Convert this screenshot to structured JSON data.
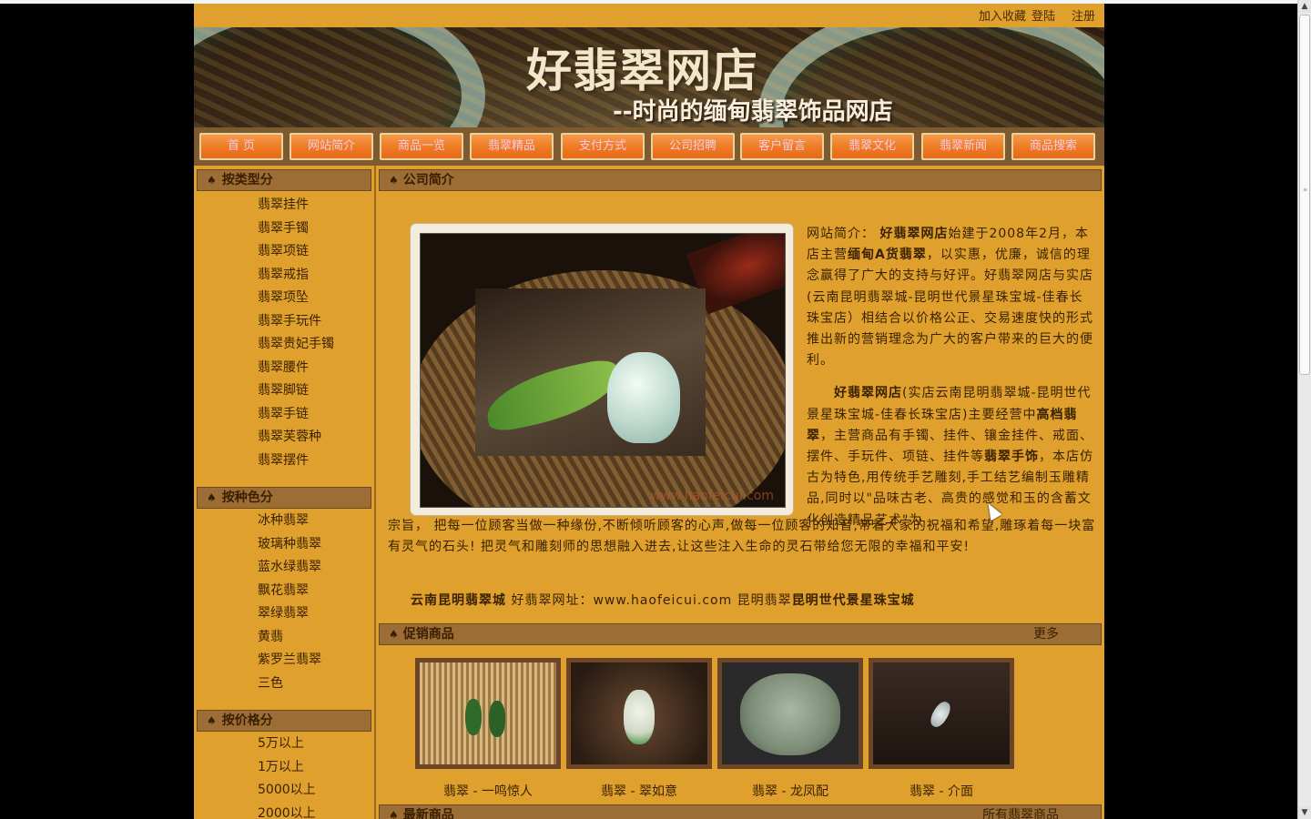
{
  "header": {
    "links": [
      "加入收藏",
      "登陆",
      "注册"
    ],
    "title": "好翡翠网店",
    "subtitle": "--时尚的缅甸翡翠饰品网店"
  },
  "nav": [
    "首 页",
    "网站简介",
    "商品一览",
    "翡翠精品",
    "支付方式",
    "公司招聘",
    "客户留言",
    "翡翠文化",
    "翡翠新闻",
    "商品搜索"
  ],
  "sidebar": {
    "type": {
      "title": "按类型分",
      "items": [
        "翡翠挂件",
        "翡翠手镯",
        "翡翠项链",
        "翡翠戒指",
        "翡翠项坠",
        "翡翠手玩件",
        "翡翠贵妃手镯",
        "翡翠腰件",
        "翡翠脚链",
        "翡翠手链",
        "翡翠芙蓉种",
        "翡翠摆件"
      ]
    },
    "color": {
      "title": "按种色分",
      "items": [
        "冰种翡翠",
        "玻璃种翡翠",
        "蓝水绿翡翠",
        "飘花翡翠",
        "翠绿翡翠",
        "黄翡",
        "紫罗兰翡翠",
        "三色"
      ]
    },
    "price": {
      "title": "按价格分",
      "items": [
        "5万以上",
        "1万以上",
        "5000以上",
        "2000以上"
      ]
    }
  },
  "about": {
    "title": "公司简介",
    "watermark": "www.haofeicui.com",
    "p1_label": "网站简介：",
    "p1_brand": "好翡翠网店",
    "p1_a": "始建于2008年2月，本店主营",
    "p1_b": "缅甸A货翡翠",
    "p1_c": "，以实惠，优廉，诚信的理念赢得了广大的支持与好评。好翡翠网店与实店(云南昆明翡翠城-昆明世代景星珠宝城-佳春长珠宝店）相结合以价格公正、交易速度快的形式推出新的营销理念为广大的客户带来的巨大的便利。",
    "p2_brand": "好翡翠网店",
    "p2_a": "(实店云南昆明翡翠城-昆明世代景星珠宝城-佳春长珠宝店)主要经营中",
    "p2_b": "高档翡翠",
    "p2_c": "，主营商品有手镯、挂件、镶金挂件、戒面、摆件、手玩件、项链、挂件等",
    "p2_d": "翡翠手饰",
    "p2_e": "，本店仿古为特色,用传统手艺雕刻,手工结艺编制玉雕精品,同时以\"品味古老、高贵的感觉和玉的含蓄文化创造精品艺术\"为",
    "p2_cont": "宗旨，  把每一位顾客当做一种缘份,不断倾听顾客的心声,做每一位顾客的知音,带着大家的祝福和希望,雕琢着每一块富有灵气的石头! 把灵气和雕刻师的思想融入进去,让这些注入生命的灵石带给您无限的幸福和平安!",
    "addr_a": "云南昆明翡翠城",
    "addr_b": " 好翡翠网址：www.haofeicui.com 昆明翡翠",
    "addr_c": "昆明世代景星珠宝城"
  },
  "promo": {
    "title": "促销商品",
    "more": "更多",
    "items": [
      "翡翠 - 一鸣惊人",
      "翡翠 - 翠如意",
      "翡翠 - 龙凤配",
      "翡翠 - 介面"
    ]
  },
  "latest": {
    "title": "最新商品",
    "more": "所有翡翠商品"
  }
}
